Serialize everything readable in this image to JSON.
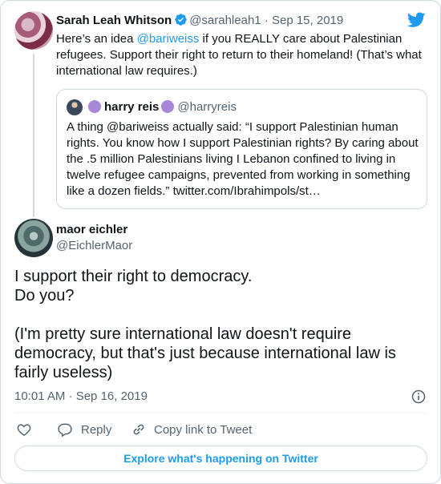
{
  "colors": {
    "accent": "#1d9bf0",
    "muted": "#536471",
    "border": "#cfd9de",
    "verified": "#1d9bf0",
    "badge_purple": "#a887d9"
  },
  "parent": {
    "author_name": "Sarah Leah Whitson",
    "handle": "@sarahleah1",
    "separator": "·",
    "date": "Sep 15, 2019",
    "text_before": "Here’s an idea ",
    "mention": "@bariweiss",
    "text_after": " if you REALLY care about Palestinian refugees. Support their right to return to their homeland! (That’s what international law requires.)",
    "icons": {
      "verified": "verified-badge-icon",
      "logo": "twitter-bird-icon"
    }
  },
  "quote": {
    "author_name": "harry reis",
    "handle": "@harryreis",
    "text": "A thing @bariweiss actually said: “I support Palestinian human rights. You know how I support Palestinian rights? By caring about the .5 million Palestinians living I Lebanon confined to living in twelve refugee campaigns, prevented from working in something like a dozen fields.” twitter.com/Ibrahimpols/st…"
  },
  "tweet": {
    "author_name": "maor eichler",
    "handle": "@EichlerMaor",
    "line1": "I support their right to democracy.",
    "line2": "Do you?",
    "line3": "(I'm pretty sure international law doesn't require democracy, but that's just because international law is fairly useless)",
    "timestamp": "10:01 AM · Sep 16, 2019"
  },
  "actions": {
    "reply_label": "Reply",
    "copy_label": "Copy link to Tweet",
    "icons": [
      "heart-icon",
      "reply-icon",
      "link-icon",
      "info-icon"
    ]
  },
  "footer": {
    "explore_label": "Explore what's happening on Twitter"
  }
}
